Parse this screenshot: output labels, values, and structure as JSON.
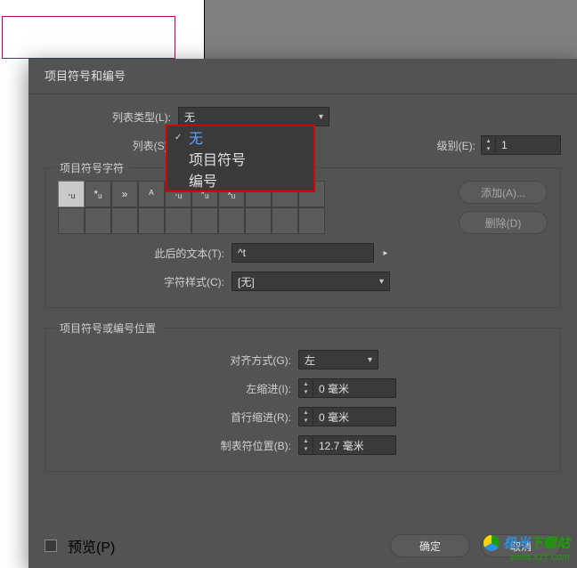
{
  "dialog": {
    "title": "项目符号和编号",
    "list_type_label": "列表类型(L):",
    "list_type_value": "无",
    "list_label": "列表(S):",
    "level_label": "级别(E):",
    "level_value": "1"
  },
  "dropdown": {
    "items": [
      {
        "label": "无",
        "checked": true
      },
      {
        "label": "项目符号",
        "checked": false
      },
      {
        "label": "编号",
        "checked": false
      }
    ]
  },
  "glyph_group": {
    "legend": "项目符号字符",
    "glyphs": [
      "·ᵤ",
      "*ᵤ",
      "»",
      "ᴬ",
      "·ᵤ",
      "*ᵤ",
      "ˣᵤ"
    ],
    "add_btn": "添加(A)...",
    "delete_btn": "删除(D)",
    "text_after_label": "此后的文本(T):",
    "text_after_value": "^t",
    "char_style_label": "字符样式(C):",
    "char_style_value": "[无]"
  },
  "position_group": {
    "legend": "项目符号或编号位置",
    "align_label": "对齐方式(G):",
    "align_value": "左",
    "left_indent_label": "左缩进(I):",
    "left_indent_value": "0 毫米",
    "first_indent_label": "首行缩进(R):",
    "first_indent_value": "0 毫米",
    "tab_pos_label": "制表符位置(B):",
    "tab_pos_value": "12.7 毫米"
  },
  "footer": {
    "preview_label": "预览(P)",
    "ok": "确定",
    "cancel": "取消"
  },
  "watermark": {
    "line1a": "极光",
    "line1b": "下载站",
    "line2": "www.xz7.com"
  }
}
